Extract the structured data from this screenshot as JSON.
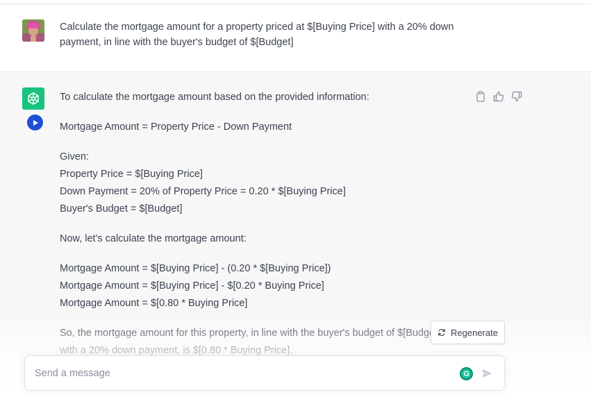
{
  "conversation": {
    "user_message": "Calculate the mortgage amount for a property priced at $[Buying Price] with a 20% down payment, in line with the buyer's budget of $[Budget]",
    "assistant": {
      "intro": "To calculate the mortgage amount based on the provided information:",
      "formula": "Mortgage Amount = Property Price - Down Payment",
      "given_heading": "Given:",
      "given": [
        "Property Price = $[Buying Price]",
        "Down Payment = 20% of Property Price = 0.20 * $[Buying Price]",
        "Buyer's Budget = $[Budget]"
      ],
      "now": "Now, let's calculate the mortgage amount:",
      "steps": [
        "Mortgage Amount = $[Buying Price] - (0.20 * $[Buying Price])",
        "Mortgage Amount = $[Buying Price] - $[0.20 * Buying Price]",
        "Mortgage Amount = $[0.80 * Buying Price]"
      ],
      "conclusion": "So, the mortgage amount for this property, in line with the buyer's budget of $[Budget], with a 20% down payment, is $[0.80 * Buying Price]."
    }
  },
  "icons": {
    "copy": "clipboard-icon",
    "like": "thumbs-up-icon",
    "dislike": "thumbs-down-icon",
    "play": "play-icon",
    "regenerate": "refresh-icon",
    "send": "send-icon",
    "grammarly": "grammarly-icon"
  },
  "regenerate_label": "Regenerate",
  "composer": {
    "placeholder": "Send a message",
    "value": ""
  },
  "colors": {
    "gpt_green": "#19c37d",
    "play_blue": "#1f4fd1",
    "assistant_bg": "#f7f7f8"
  }
}
